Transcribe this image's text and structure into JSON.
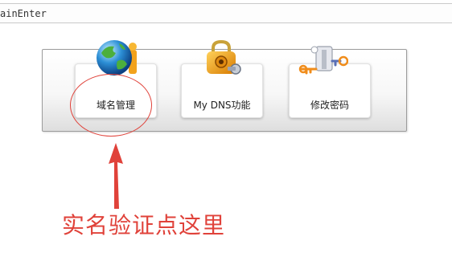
{
  "address_bar": {
    "text": "ainEnter"
  },
  "tiles": [
    {
      "label": "域名管理",
      "icon": "globe-icon"
    },
    {
      "label": "My DNS功能",
      "icon": "padlock-icon"
    },
    {
      "label": "修改密码",
      "icon": "key-icon"
    }
  ],
  "annotation": {
    "text": "实名验证点这里",
    "color": "#e0423a"
  }
}
